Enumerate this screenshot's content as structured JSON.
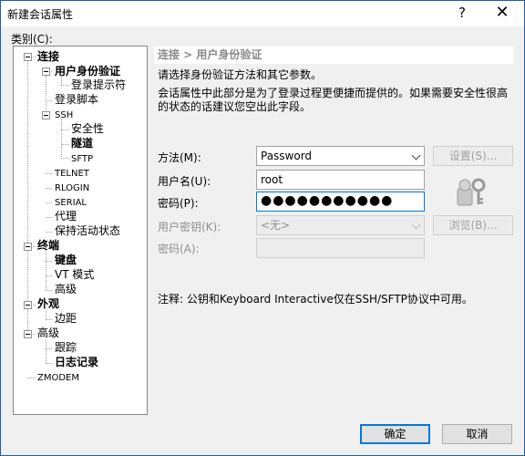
{
  "window": {
    "title": "新建会话属性",
    "help_glyph": "?",
    "close_glyph": "✕"
  },
  "category_label": "类别(C):",
  "tree": {
    "connection": "连接",
    "user_auth": "用户身份验证",
    "login_prompt": "登录提示符",
    "login_script": "登录脚本",
    "ssh": "SSH",
    "security": "安全性",
    "tunnel": "隧道",
    "sftp": "SFTP",
    "telnet": "TELNET",
    "rlogin": "RLOGIN",
    "serial": "SERIAL",
    "proxy": "代理",
    "keepalive": "保持活动状态",
    "terminal": "终端",
    "keyboard": "键盘",
    "vt_mode": "VT 模式",
    "terminal_advanced": "高级",
    "appearance": "外观",
    "margin": "边距",
    "advanced": "高级",
    "trace": "跟踪",
    "logging": "日志记录",
    "zmodem": "ZMODEM"
  },
  "section_header": "连接 > 用户身份验证",
  "description": {
    "line1": "请选择身份验证方法和其它参数。",
    "line2": "会话属性中此部分是为了登录过程更便捷而提供的。如果需要安全性很高",
    "line3": "的状态的话建议您空出此字段。"
  },
  "form": {
    "method_label": "方法(M):",
    "method_value": "Password",
    "setup_button": "设置(S)...",
    "username_label": "用户名(U):",
    "username_value": "root",
    "password_label": "密码(P):",
    "password_value": "●●●●●●●●●●●",
    "user_key_label": "用户密钥(K):",
    "user_key_value": "<无>",
    "browse_button": "浏览(B)...",
    "passphrase_label": "密码(A):",
    "passphrase_value": ""
  },
  "note": "注释: 公钥和Keyboard Interactive仅在SSH/SFTP协议中可用。",
  "footer": {
    "ok": "确定",
    "cancel": "取消"
  }
}
